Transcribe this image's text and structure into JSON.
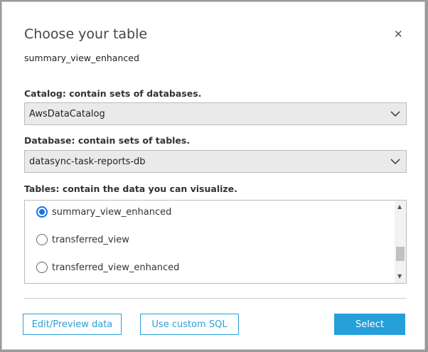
{
  "dialog": {
    "title": "Choose your table",
    "close_icon": "close-icon",
    "subtitle": "summary_view_enhanced"
  },
  "catalog": {
    "label": "Catalog: contain sets of databases.",
    "value": "AwsDataCatalog"
  },
  "database": {
    "label": "Database: contain sets of tables.",
    "value": "datasync-task-reports-db"
  },
  "tables": {
    "label": "Tables: contain the data you can visualize.",
    "items": [
      {
        "name": "summary_view_enhanced",
        "selected": true
      },
      {
        "name": "transferred_view",
        "selected": false
      },
      {
        "name": "transferred_view_enhanced",
        "selected": false
      }
    ]
  },
  "buttons": {
    "edit": "Edit/Preview data",
    "sql": "Use custom SQL",
    "select": "Select"
  },
  "colors": {
    "accent": "#249fd9",
    "radio": "#1a73e8"
  }
}
